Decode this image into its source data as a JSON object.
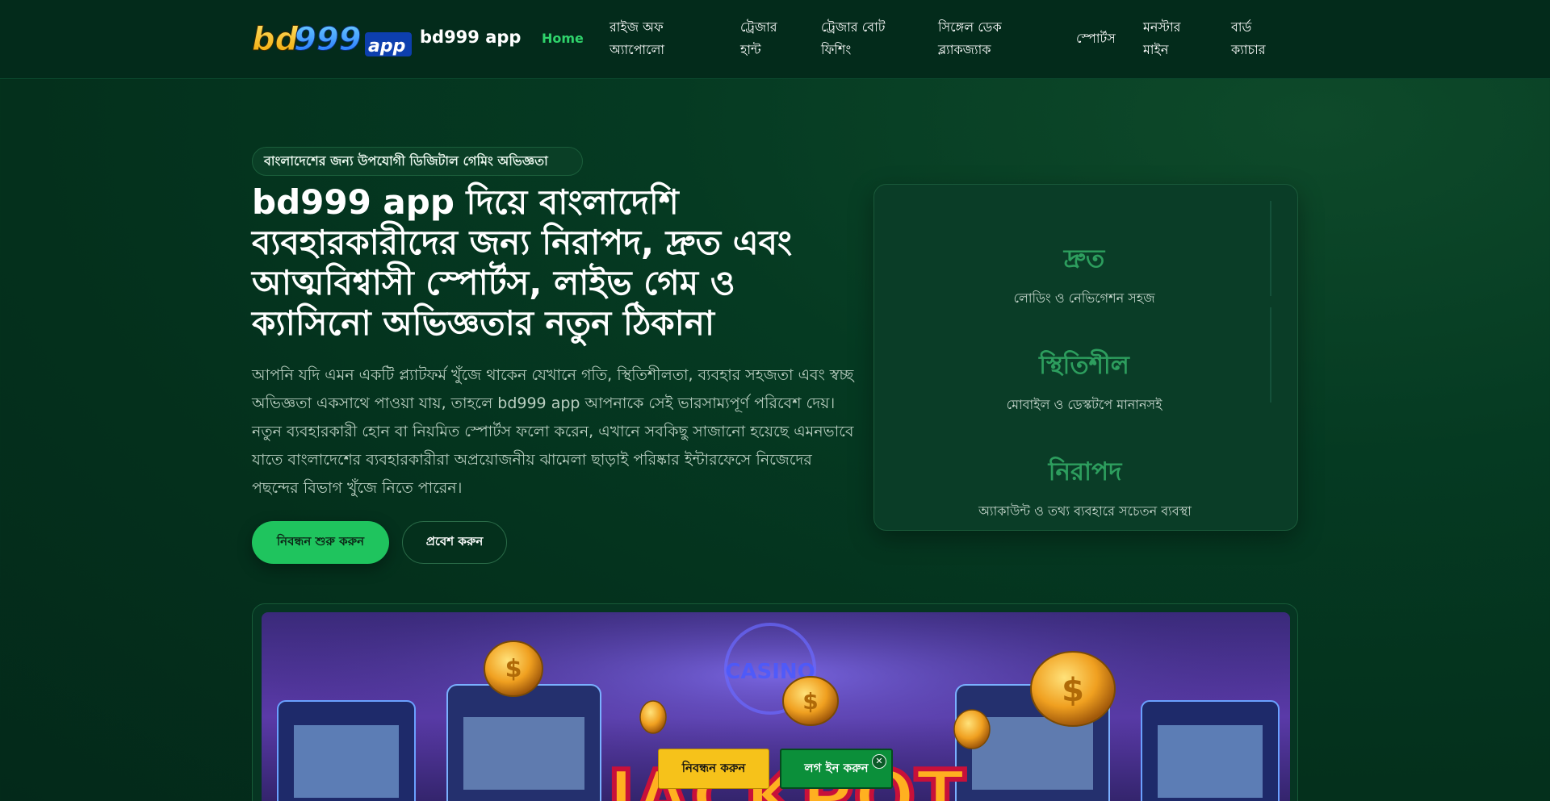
{
  "header": {
    "logo_text": "bd999app",
    "brand": "bd999 app",
    "nav": [
      {
        "label": "Home",
        "active": true
      },
      {
        "label_line1": "রাইজ অফ",
        "label_line2": "অ্যাপোলো"
      },
      {
        "label_line1": "ট্রেজার",
        "label_line2": "হান্ট"
      },
      {
        "label_line1": "ট্রেজার বোট",
        "label_line2": "ফিশিং"
      },
      {
        "label_line1": "সিঙ্গেল ডেক",
        "label_line2": "ব্ল্যাকজ্যাক"
      },
      {
        "label": "স্পোর্টস"
      },
      {
        "label_line1": "মনস্টার",
        "label_line2": "মাইন"
      },
      {
        "label_line1": "বার্ড",
        "label_line2": "ক্যাচার"
      }
    ]
  },
  "hero": {
    "pill": "বাংলাদেশের জন্য উপযোগী ডিজিটাল গেমিং অভিজ্ঞতা",
    "title": "bd999 app দিয়ে বাংলাদেশি ব্যবহারকারীদের জন্য নিরাপদ, দ্রুত এবং আত্মবিশ্বাসী স্পোর্টস, লাইভ গেম ও ক্যাসিনো অভিজ্ঞতার নতুন ঠিকানা",
    "description": "আপনি যদি এমন একটি প্ল্যাটফর্ম খুঁজে থাকেন যেখানে গতি, স্থিতিশীলতা, ব্যবহার সহজতা এবং স্বচ্ছ অভিজ্ঞতা একসাথে পাওয়া যায়, তাহলে bd999 app আপনাকে সেই ভারসাম্যপূর্ণ পরিবেশ দেয়। নতুন ব্যবহারকারী হোন বা নিয়মিত স্পোর্টস ফলো করেন, এখানে সবকিছু সাজানো হয়েছে এমনভাবে যাতে বাংলাদেশের ব্যবহারকারীরা অপ্রয়োজনীয় ঝামেলা ছাড়াই পরিষ্কার ইন্টারফেসে নিজেদের পছন্দের বিভাগ খুঁজে নিতে পারেন।",
    "btn_register": "নিবন্ধন শুরু করুন",
    "btn_enter": "প্রবেশ করুন"
  },
  "features": [
    {
      "title": "দ্রুত",
      "subtitle": "লোডিং ও নেভিগেশন সহজ"
    },
    {
      "title": "স্থিতিশীল",
      "subtitle": "মোবাইল ও ডেস্কটপে মানানসই"
    },
    {
      "title": "নিরাপদ",
      "subtitle": "অ্যাকাউন্ট ও তথ্য ব্যবহারে সচেতন ব্যবস্থা"
    }
  ],
  "banner": {
    "jackpot_text": "JACKPOT",
    "casino_text": "CASINO"
  },
  "sticky": {
    "register": "নিবন্ধন করুন",
    "login": "লগ ইন করুন",
    "close": "✕"
  },
  "colors": {
    "accent_green": "#1fc45e",
    "feature_green": "#2d9e5e",
    "register_yellow": "#f6c21a",
    "login_green": "#0b8f3a"
  }
}
